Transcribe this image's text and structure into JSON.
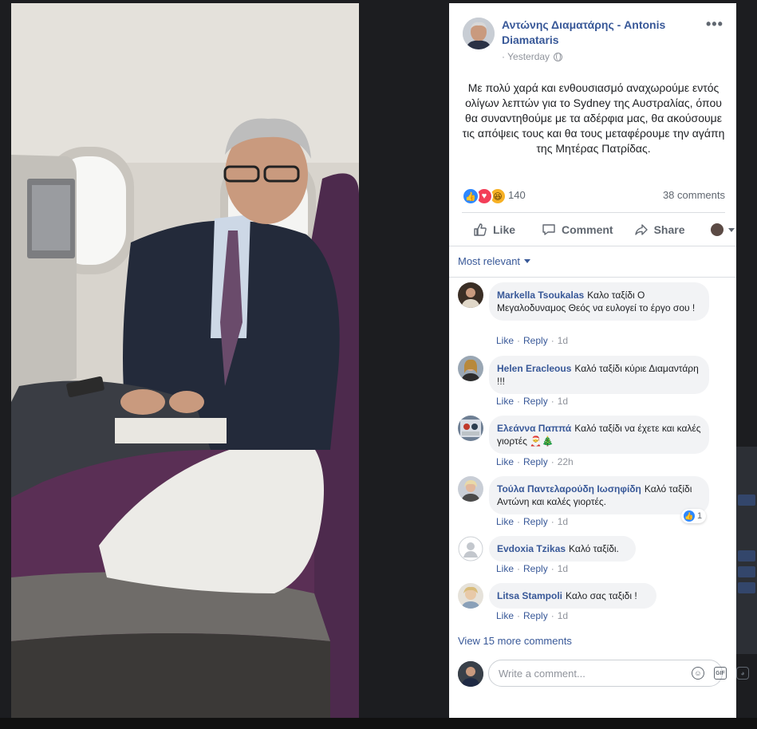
{
  "post": {
    "author": "Αντώνης Διαματάρης - Antonis Diamataris",
    "time": "· Yesterday",
    "text": "Με πολύ χαρά και ενθουσιασμό αναχωρούμε εντός ολίγων λεπτών για το Sydney της Αυστραλίας, όπου θα συναντηθούμε με τα αδέρφια μας, θα ακούσουμε τις απόψεις τους και θα τους μεταφέρουμε την αγάπη της Μητέρας Πατρίδας.",
    "reaction_count": "140",
    "comment_count": "38 comments",
    "more_icon": "•••"
  },
  "actions": {
    "like": "Like",
    "comment": "Comment",
    "share": "Share"
  },
  "sort": {
    "label": "Most relevant"
  },
  "comments": [
    {
      "name": "Markella Tsoukalas",
      "text": "Καλο ταξίδι Ο Μεγαλοδυναμος Θεός να ευλογεί το έργο σου !",
      "like": "Like",
      "reply": "Reply",
      "time": "1d"
    },
    {
      "name": "Helen Eracleous",
      "text": "Καλό ταξίδι κύριε Διαμαντάρη !!!",
      "like": "Like",
      "reply": "Reply",
      "time": "1d"
    },
    {
      "name": "Ελεάννα Παππά",
      "text": "Καλό ταξίδι να έχετε και καλές γιορτές 🎅🎄",
      "like": "Like",
      "reply": "Reply",
      "time": "22h"
    },
    {
      "name": "Τούλα Παντελαρούδη Ιωσηφίδη",
      "text": "Καλό ταξίδι Αντώνη και καλές γιορτές.",
      "like": "Like",
      "reply": "Reply",
      "time": "1d",
      "likes": "1"
    },
    {
      "name": "Evdoxia Tzikas",
      "text": "Καλό ταξίδι.",
      "like": "Like",
      "reply": "Reply",
      "time": "1d"
    },
    {
      "name": "Litsa Stampoli",
      "text": "Καλο σας ταξιδι !",
      "like": "Like",
      "reply": "Reply",
      "time": "1d"
    }
  ],
  "view_more": "View 15 more comments",
  "composer": {
    "placeholder": "Write a comment..."
  },
  "colors": {
    "link": "#385898",
    "muted": "#606770",
    "bubble": "#f2f3f5",
    "like_blue": "#2d88ff"
  }
}
